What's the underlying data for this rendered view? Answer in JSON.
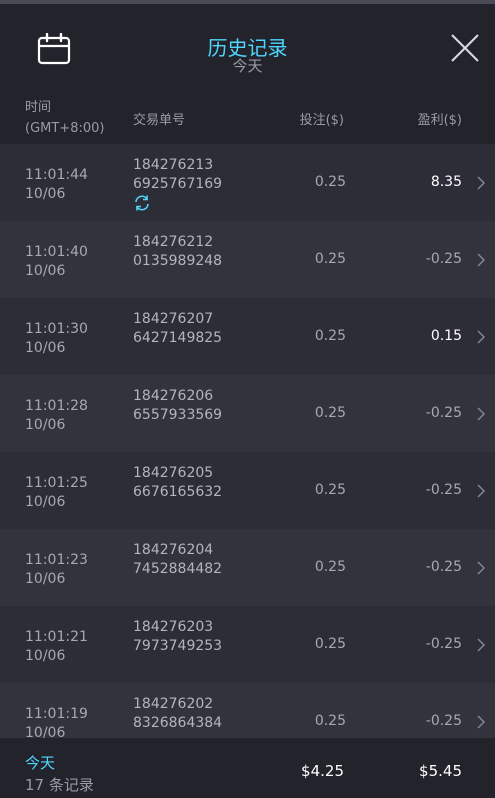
{
  "header": {
    "title": "历史记录",
    "subtitle": "今天"
  },
  "columns": {
    "time_line1": "时间",
    "time_line2": "(GMT+8:00)",
    "order": "交易单号",
    "stake": "投注($)",
    "profit": "盈利($)"
  },
  "rows": [
    {
      "time": "11:01:44",
      "date": "10/06",
      "order_a": "184276213",
      "order_b": "6925767169",
      "stake": "0.25",
      "profit": "8.35",
      "positive": true,
      "refresh": true
    },
    {
      "time": "11:01:40",
      "date": "10/06",
      "order_a": "184276212",
      "order_b": "0135989248",
      "stake": "0.25",
      "profit": "-0.25",
      "positive": false,
      "refresh": false
    },
    {
      "time": "11:01:30",
      "date": "10/06",
      "order_a": "184276207",
      "order_b": "6427149825",
      "stake": "0.25",
      "profit": "0.15",
      "positive": true,
      "refresh": false
    },
    {
      "time": "11:01:28",
      "date": "10/06",
      "order_a": "184276206",
      "order_b": "6557933569",
      "stake": "0.25",
      "profit": "-0.25",
      "positive": false,
      "refresh": false
    },
    {
      "time": "11:01:25",
      "date": "10/06",
      "order_a": "184276205",
      "order_b": "6676165632",
      "stake": "0.25",
      "profit": "-0.25",
      "positive": false,
      "refresh": false
    },
    {
      "time": "11:01:23",
      "date": "10/06",
      "order_a": "184276204",
      "order_b": "7452884482",
      "stake": "0.25",
      "profit": "-0.25",
      "positive": false,
      "refresh": false
    },
    {
      "time": "11:01:21",
      "date": "10/06",
      "order_a": "184276203",
      "order_b": "7973749253",
      "stake": "0.25",
      "profit": "-0.25",
      "positive": false,
      "refresh": false
    },
    {
      "time": "11:01:19",
      "date": "10/06",
      "order_a": "184276202",
      "order_b": "8326864384",
      "stake": "0.25",
      "profit": "-0.25",
      "positive": false,
      "refresh": false
    }
  ],
  "footer": {
    "today": "今天",
    "count": "17 条记录",
    "total_stake": "$4.25",
    "total_profit": "$5.45"
  },
  "colors": {
    "accent": "#4fd7ff",
    "header_bg": "#23232c",
    "row_odd": "#2d2d38",
    "row_even": "#33333e"
  }
}
